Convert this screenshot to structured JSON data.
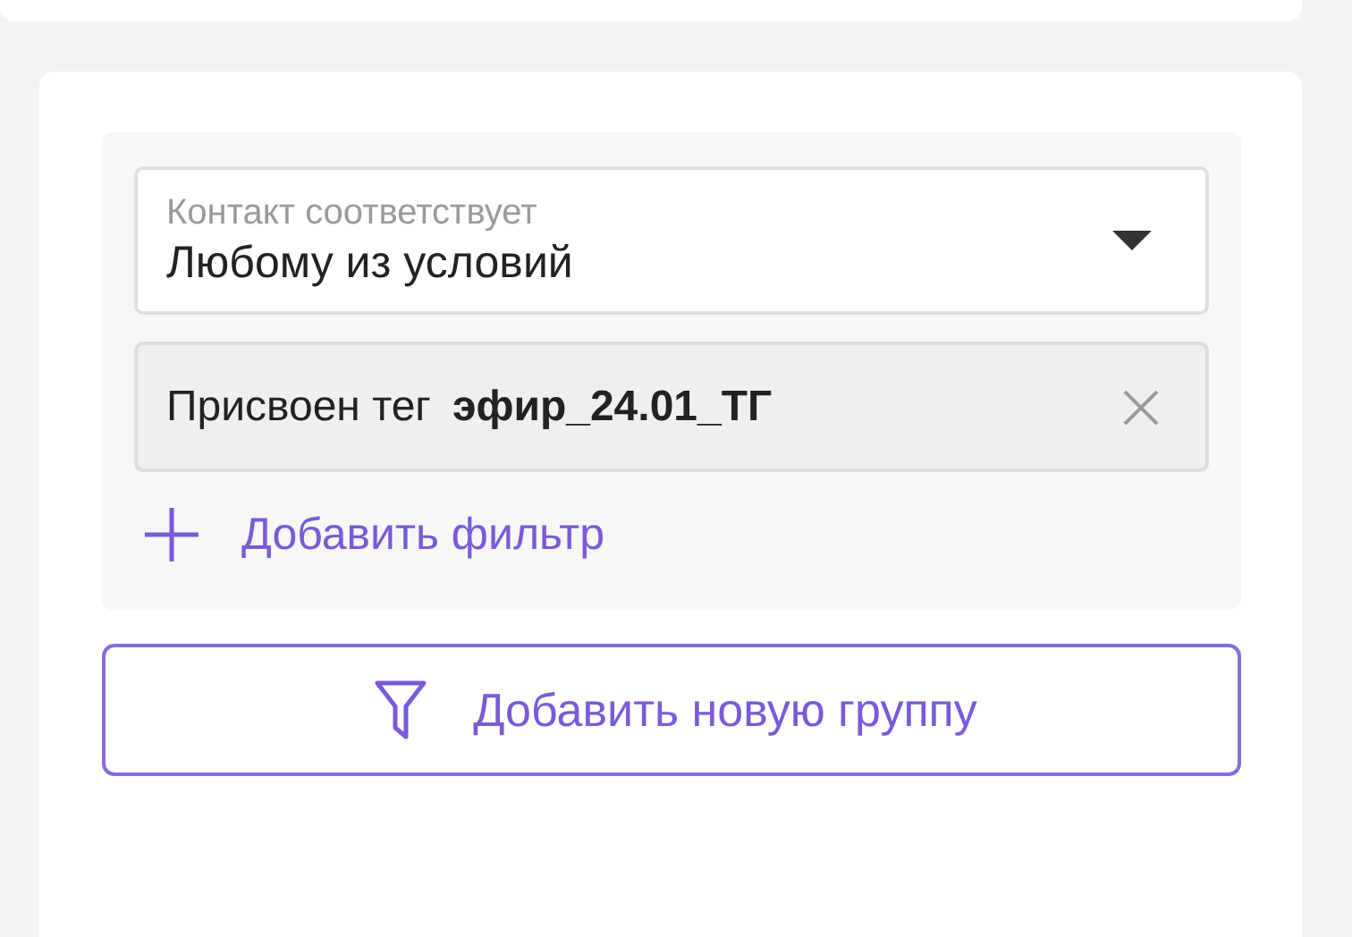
{
  "filter_group": {
    "match_select": {
      "label": "Контакт соответствует",
      "value": "Любому из условий"
    },
    "filters": [
      {
        "label": "Присвоен тег",
        "value": "эфир_24.01_ТГ"
      }
    ],
    "add_filter": "Добавить фильтр"
  },
  "add_group_button": "Добавить новую группу"
}
